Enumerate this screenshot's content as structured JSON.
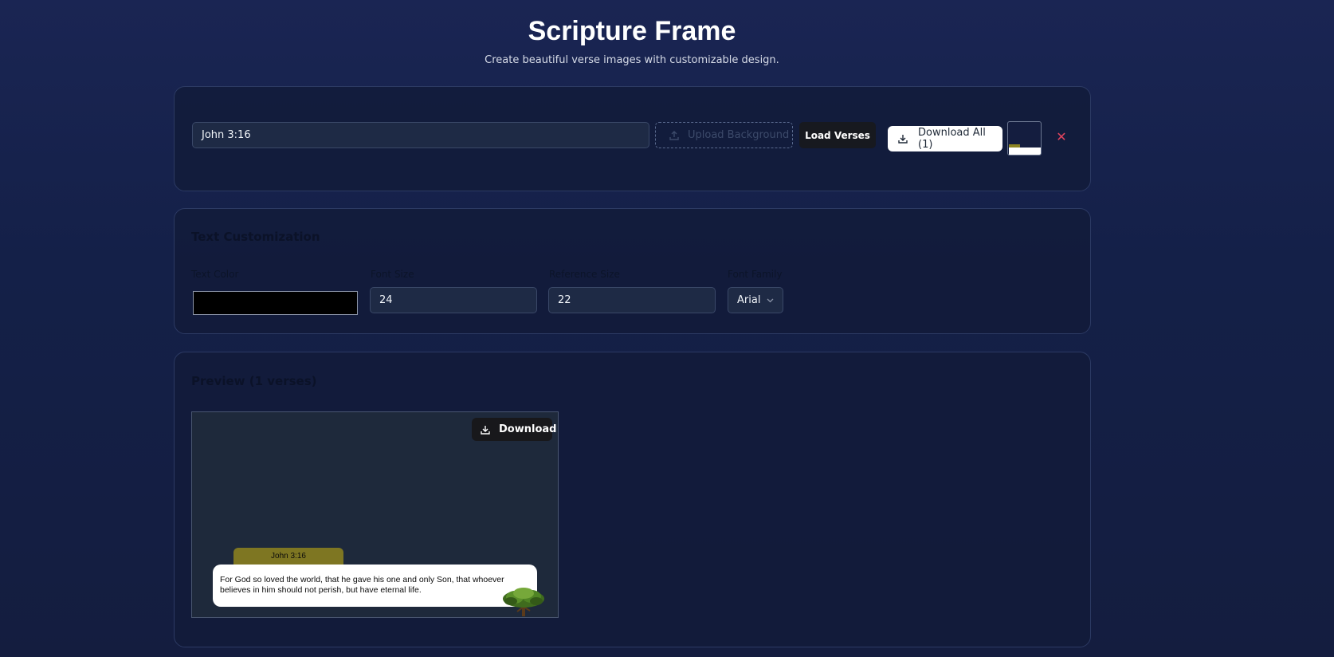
{
  "header": {
    "title": "Scripture Frame",
    "subtitle": "Create beautiful verse images with customizable design."
  },
  "controls": {
    "verse_input_value": "John 3:16",
    "upload_label": "Upload Background",
    "load_label": "Load Verses",
    "download_all_label": "Download All (1)",
    "close_symbol": "✕"
  },
  "customization": {
    "title": "Text Customization",
    "text_color_label": "Text Color",
    "text_color_value": "#000000",
    "font_size_label": "Font Size",
    "font_size_value": "24",
    "reference_size_label": "Reference Size",
    "reference_size_value": "22",
    "font_family_label": "Font Family",
    "font_family_value": "Arial"
  },
  "preview": {
    "title": "Preview (1 verses)",
    "download_label": "Download",
    "reference": "John 3:16",
    "verse_text": "For God so loved the world, that he gave his one and only Son, that whoever believes in him should not perish, but have eternal life."
  },
  "colors": {
    "background": "#152046",
    "card": "#121b3a",
    "accent_close": "#e0445e",
    "reference_tab": "#7e7622",
    "preview_bg": "#1e293b"
  },
  "icons": [
    "upload-icon",
    "download-icon",
    "close-icon",
    "chevron-down-icon",
    "tree-icon"
  ]
}
